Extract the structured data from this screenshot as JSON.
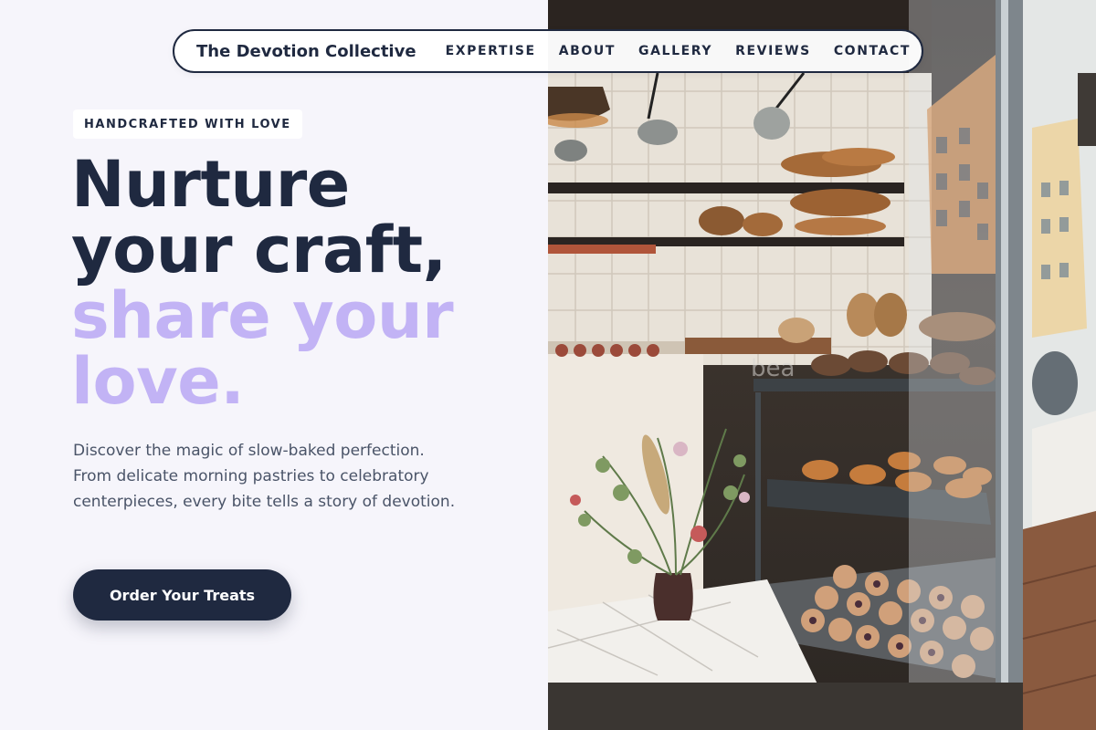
{
  "nav": {
    "brand": "The Devotion Collective",
    "links": [
      "EXPERTISE",
      "ABOUT",
      "GALLERY",
      "REVIEWS",
      "CONTACT"
    ]
  },
  "hero": {
    "badge": "HANDCRAFTED WITH LOVE",
    "headline_dark_1": "Nurture",
    "headline_dark_2": "your craft,",
    "headline_accent_1": "share your",
    "headline_accent_2": "love.",
    "description": "Discover the magic of slow-baked perfection. From delicate morning pastries to celebratory centerpieces, every bite tells a story of devotion.",
    "cta_label": "Order Your Treats"
  },
  "photo": {
    "window_text": "bea"
  },
  "colors": {
    "primary": "#1f2940",
    "accent": "#c2b3f5",
    "background": "#f6f5fb",
    "body_text": "#4a5468"
  }
}
